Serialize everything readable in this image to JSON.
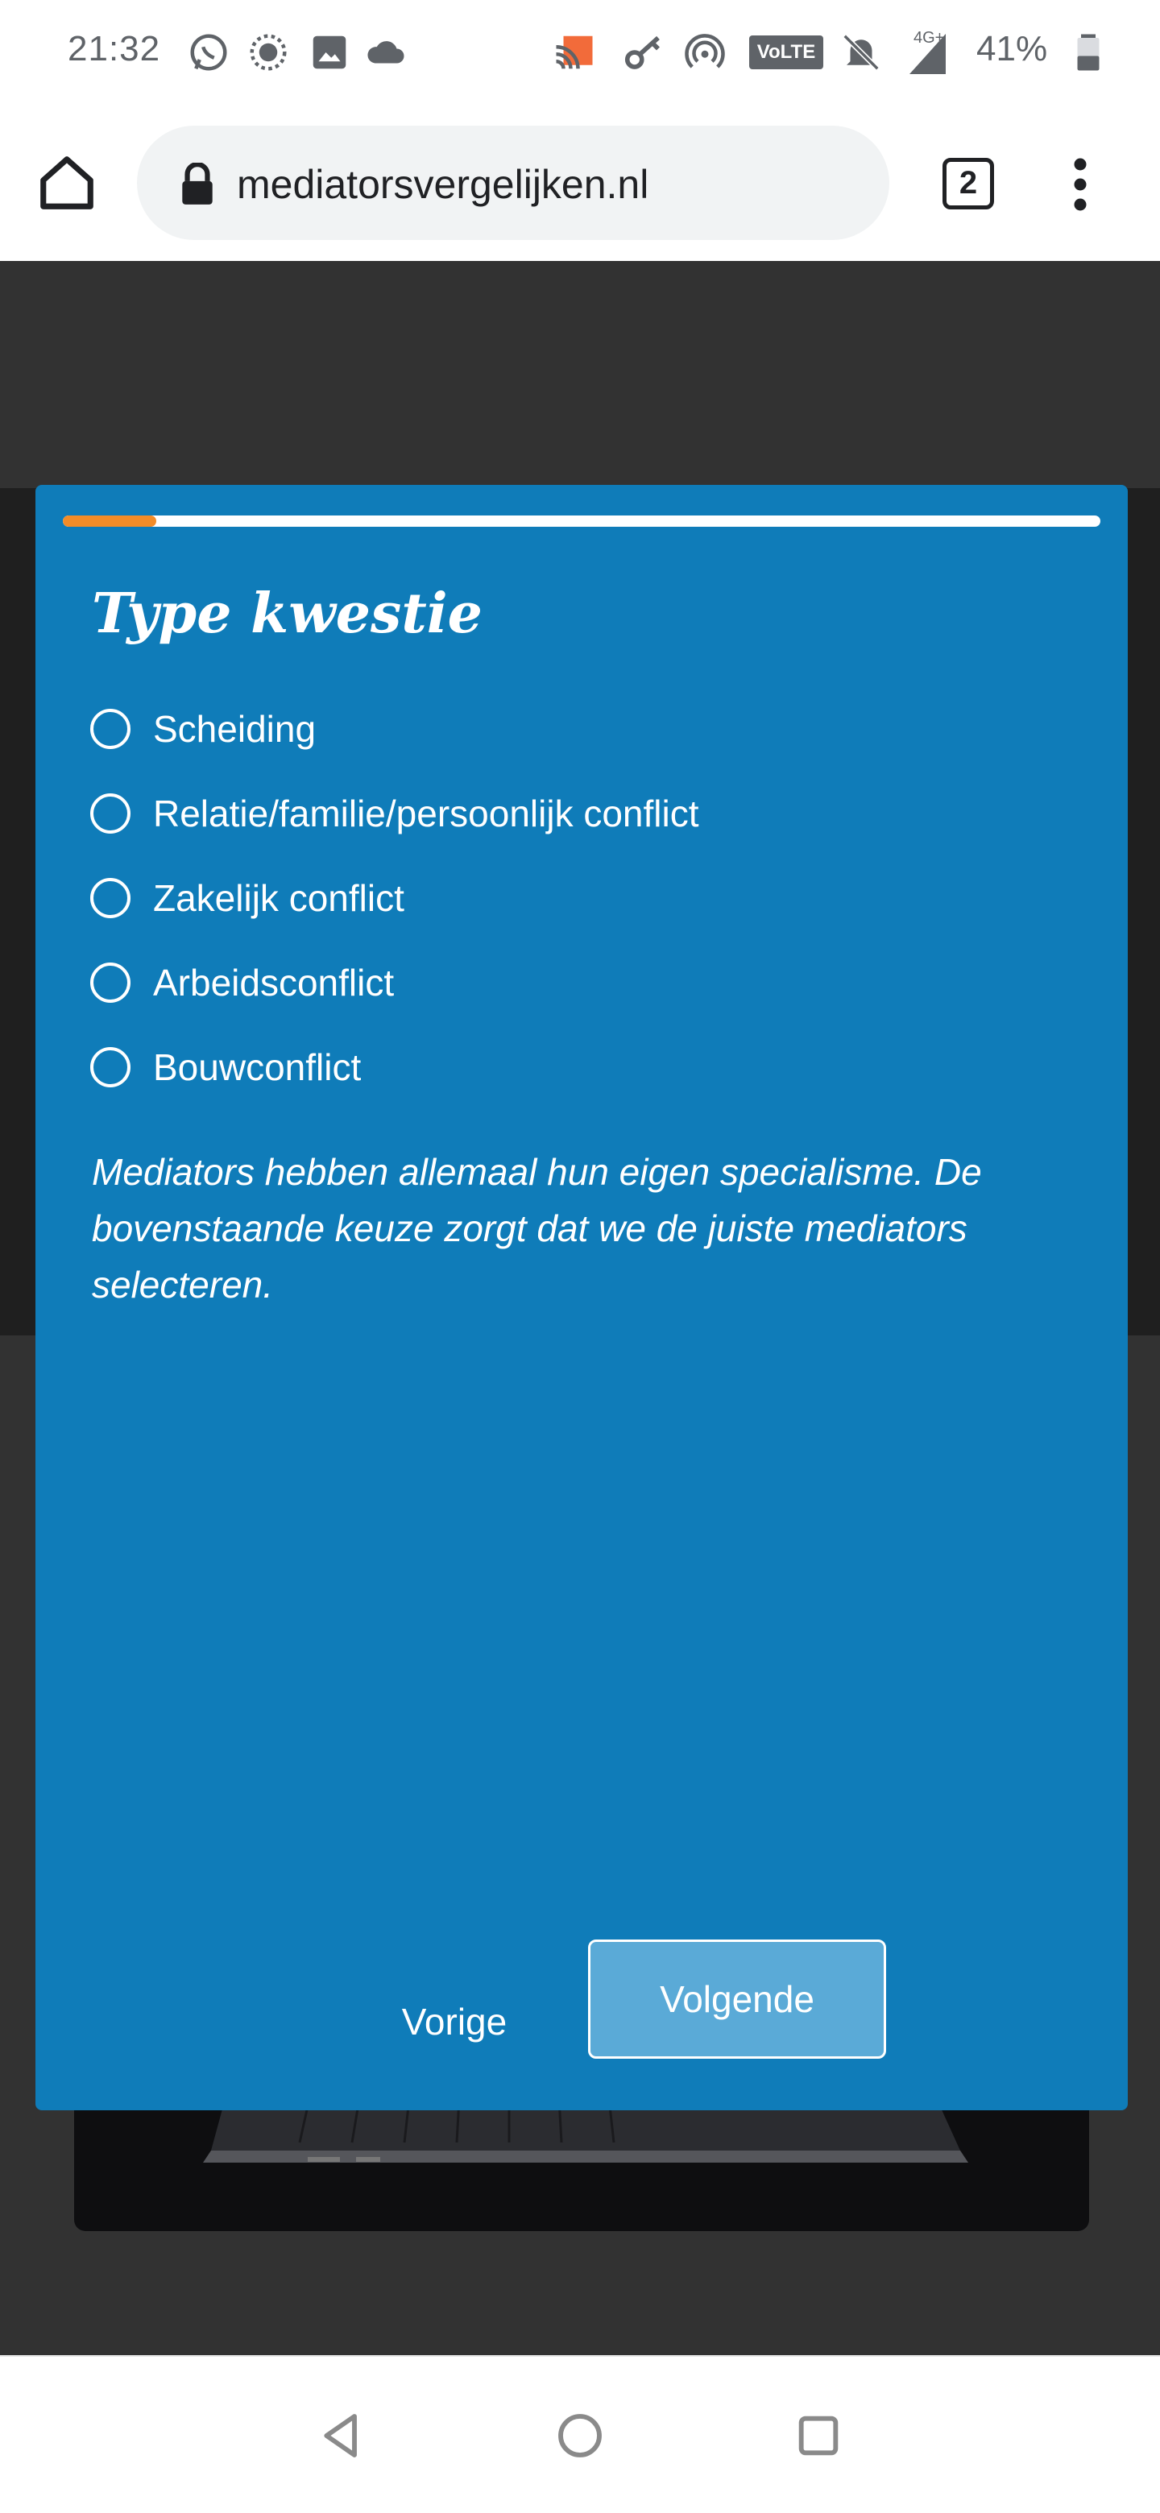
{
  "status_bar": {
    "time": "21:32",
    "battery_percent": "41%",
    "icons": [
      "whatsapp-icon",
      "burst-icon",
      "gallery-icon",
      "cloud-icon",
      "cast-icon",
      "key-icon",
      "hotspot-icon",
      "volte-icon",
      "mute-icon",
      "signal-icon",
      "battery-icon"
    ],
    "volte_label": "VoLTE",
    "network_label": "4G+"
  },
  "browser": {
    "url": "mediatorsvergelijken.nl",
    "tab_count": "2"
  },
  "modal": {
    "progress": 0.09,
    "title": "Type kwestie",
    "options": [
      {
        "label": "Scheiding"
      },
      {
        "label": "Relatie/familie/persoonlijk conflict"
      },
      {
        "label": "Zakelijk conflict"
      },
      {
        "label": "Arbeidsconflict"
      },
      {
        "label": "Bouwconflict"
      }
    ],
    "info": "Mediators hebben allemaal hun eigen specialisme. De bovenstaande keuze zorgt dat we de juiste mediators selecteren.",
    "prev_label": "Vorige",
    "next_label": "Volgende"
  },
  "colors": {
    "modal_bg": "#0f7cb9",
    "progress_fill": "#f28c28",
    "next_button_bg": "#5aaad7",
    "page_bg": "#323232"
  }
}
